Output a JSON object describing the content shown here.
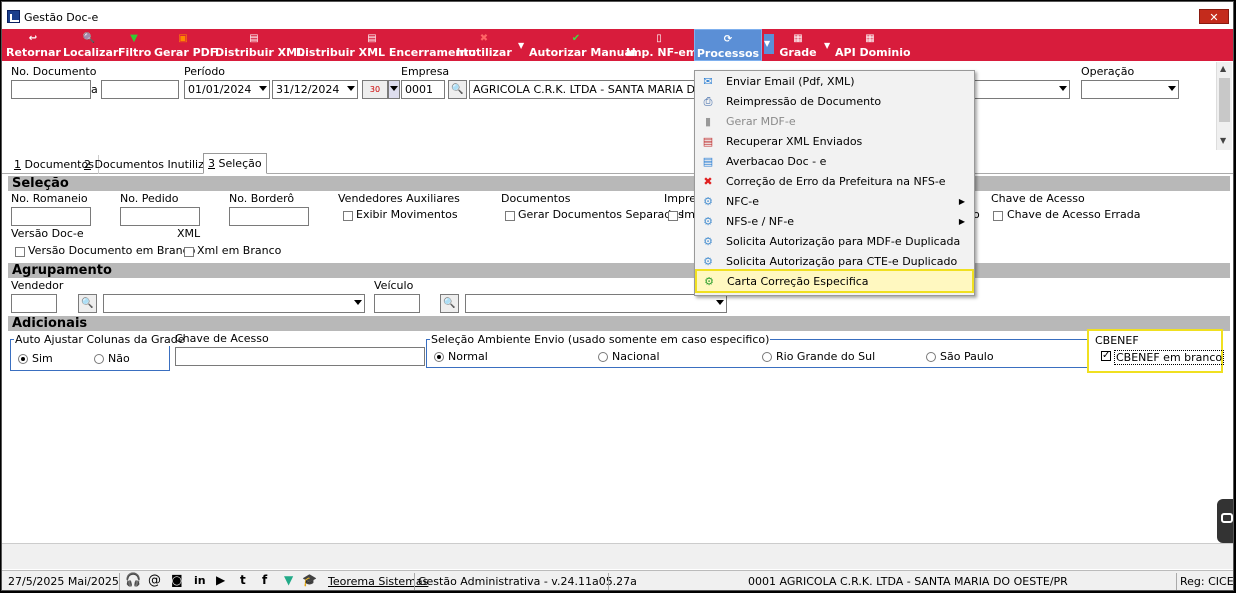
{
  "window": {
    "title": "Gestão Doc-e",
    "close": "✕"
  },
  "toolbar": {
    "items": [
      {
        "label": "Retornar",
        "icon": "↩"
      },
      {
        "label": "Localizar",
        "icon": "🔍"
      },
      {
        "label": "Filtro",
        "icon": "▼"
      },
      {
        "label": "Gerar PDF",
        "icon": "▣"
      },
      {
        "label": "Distribuir XML",
        "icon": "▤"
      },
      {
        "label": "Distribuir XML Encerramento",
        "icon": "▤"
      },
      {
        "label": "Inutilizar",
        "icon": "✖"
      },
      {
        "label": "Autorizar Manual",
        "icon": "✔"
      },
      {
        "label": "Imp. NF-em",
        "icon": "▯"
      },
      {
        "label": "Processos",
        "icon": "⟳"
      },
      {
        "label": "Grade",
        "icon": "▦"
      },
      {
        "label": "API Dominio",
        "icon": "▦"
      }
    ]
  },
  "filters": {
    "no_documento": {
      "label": "No. Documento",
      "sep": "a"
    },
    "periodo": {
      "label": "Período",
      "start": "01/01/2024",
      "end": "31/12/2024",
      "cal_icon": "30"
    },
    "empresa": {
      "label": "Empresa",
      "code": "0001",
      "name": "AGRICOLA C.R.K. LTDA - SANTA MARIA DO OESTE/PR"
    },
    "operacao": {
      "label": "Operação"
    }
  },
  "tabs": [
    {
      "num": "1",
      "label": " Documentos"
    },
    {
      "num": "2",
      "label": " Documentos Inutilizados"
    },
    {
      "num": "3",
      "label": " Seleção"
    }
  ],
  "selecao": {
    "title": "Seleção",
    "no_romaneio": "No. Romaneio",
    "no_pedido": "No. Pedido",
    "no_bordero": "No. Borderô",
    "vendedores": "Vendedores Auxiliares",
    "exibir": "Exibir Movimentos",
    "documentos": "Documentos",
    "gerar_sep": "Gerar Documentos Separados",
    "impre": "Impre",
    "im": "Im",
    "chave_label": "Chave de Acesso",
    "chave_errada": "Chave de Acesso Errada",
    "o_frag": "o",
    "versao": "Versão Doc-e",
    "xml": "XML",
    "versao_branco": "Versão Documento em Branco",
    "xml_branco": "Xml em Branco"
  },
  "agrupamento": {
    "title": "Agrupamento",
    "vendedor": "Vendedor",
    "veiculo": "Veículo"
  },
  "adicionais": {
    "title": "Adicionais",
    "auto": {
      "label": "Auto Ajustar Colunas da Grade",
      "sim": "Sim",
      "nao": "Não"
    },
    "chave": "Chave de Acesso",
    "ambiente": {
      "label": "Seleção Ambiente Envio (usado somente em caso especifico)",
      "opts": [
        "Normal",
        "Nacional",
        "Rio Grande do Sul",
        "São Paulo"
      ]
    },
    "cbenef": {
      "label": "CBENEF",
      "check": "CBENEF em branco"
    }
  },
  "menu": {
    "items": [
      {
        "label": "Enviar Email (Pdf, XML)",
        "icon": "✉",
        "color": "#2a7fd4"
      },
      {
        "label": "Reimpressão de Documento",
        "icon": "⎙",
        "color": "#2a5aa0"
      },
      {
        "label": "Gerar MDF-e",
        "icon": "▮",
        "color": "#999999"
      },
      {
        "label": "Recuperar XML Enviados",
        "icon": "▤",
        "color": "#c03030"
      },
      {
        "label": "Averbacao Doc - e",
        "icon": "▤",
        "color": "#2a7fd4"
      },
      {
        "label": "Correção de Erro da Prefeitura na NFS-e",
        "icon": "✖",
        "color": "#e02020"
      },
      {
        "label": "NFC-e",
        "icon": "⚙",
        "color": "#4a90d0",
        "sub": "▶"
      },
      {
        "label": "NFS-e / NF-e",
        "icon": "⚙",
        "color": "#4a90d0",
        "sub": "▶"
      },
      {
        "label": "Solicita Autorização para MDF-e Duplicada",
        "icon": "⚙",
        "color": "#4a90d0"
      },
      {
        "label": "Solicita Autorização para CTE-e Duplicado",
        "icon": "⚙",
        "color": "#4a90d0"
      },
      {
        "label": "Carta Correção Especifica",
        "icon": "⚙",
        "color": "#30a030"
      }
    ]
  },
  "status": {
    "date": "27/5/2025 Mai/2025",
    "company_link": "Teorema Sistemas",
    "version": "Gestão Administrativa - v.24.11a05.27a",
    "empresa": "0001 AGRICOLA C.R.K. LTDA - SANTA MARIA DO OESTE/PR",
    "reg": "Reg: CICERO"
  }
}
